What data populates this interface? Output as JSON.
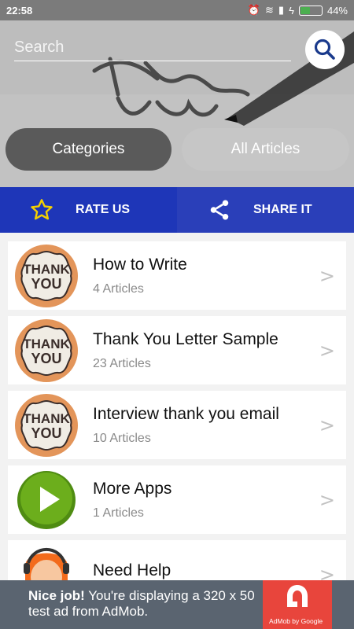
{
  "status_bar": {
    "time": "22:58",
    "battery": "44%"
  },
  "search": {
    "placeholder": "Search"
  },
  "tabs": {
    "categories": "Categories",
    "all_articles": "All Articles"
  },
  "actions": {
    "rate": "RATE US",
    "share": "SHARE IT"
  },
  "list": [
    {
      "title": "How to Write",
      "count": "4 Articles",
      "icon": "thank-you-badge"
    },
    {
      "title": "Thank You Letter Sample",
      "count": "23 Articles",
      "icon": "thank-you-badge"
    },
    {
      "title": "Interview thank you email",
      "count": "10 Articles",
      "icon": "thank-you-badge"
    },
    {
      "title": "More Apps",
      "count": "1 Articles",
      "icon": "green-play-button"
    },
    {
      "title": "Need Help",
      "count": "",
      "icon": "support-person"
    }
  ],
  "chevron": ">",
  "thumb_text": [
    "THANK",
    "YOU"
  ],
  "ad": {
    "bold": "Nice job!",
    "text": "You're displaying a 320 x 50 test ad from AdMob.",
    "credit": "AdMob by Google"
  },
  "colors": {
    "action_bar": "#1e36b8",
    "accent_search": "#1a3a8c",
    "ad_bg": "#5a6470",
    "admob_red": "#e8453c"
  }
}
